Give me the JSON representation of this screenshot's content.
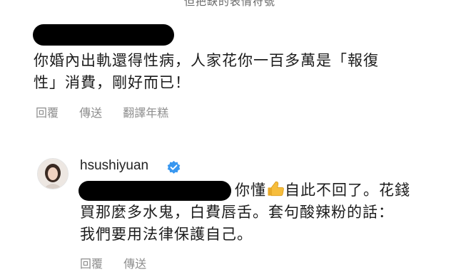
{
  "cropped_header": "但把缺的表情符號",
  "comment1": {
    "line1": "你婚內出軌還得性病，人家花你一百多萬是「報復",
    "line2": "性」消費，剛好而已！",
    "actions": {
      "reply": "回覆",
      "share": "傳送",
      "translate": "翻譯年糕"
    }
  },
  "comment2": {
    "username": "hsushiyuan",
    "line1_a": "你懂",
    "emoji_icon": "thumbs-up-icon",
    "line1_b": "自此不回了。花錢",
    "line2": "買那麼多水鬼，白費唇舌。套句酸辣粉的話：",
    "line3": "我們要用法律保護自己。",
    "actions": {
      "reply": "回覆",
      "share": "傳送"
    }
  }
}
